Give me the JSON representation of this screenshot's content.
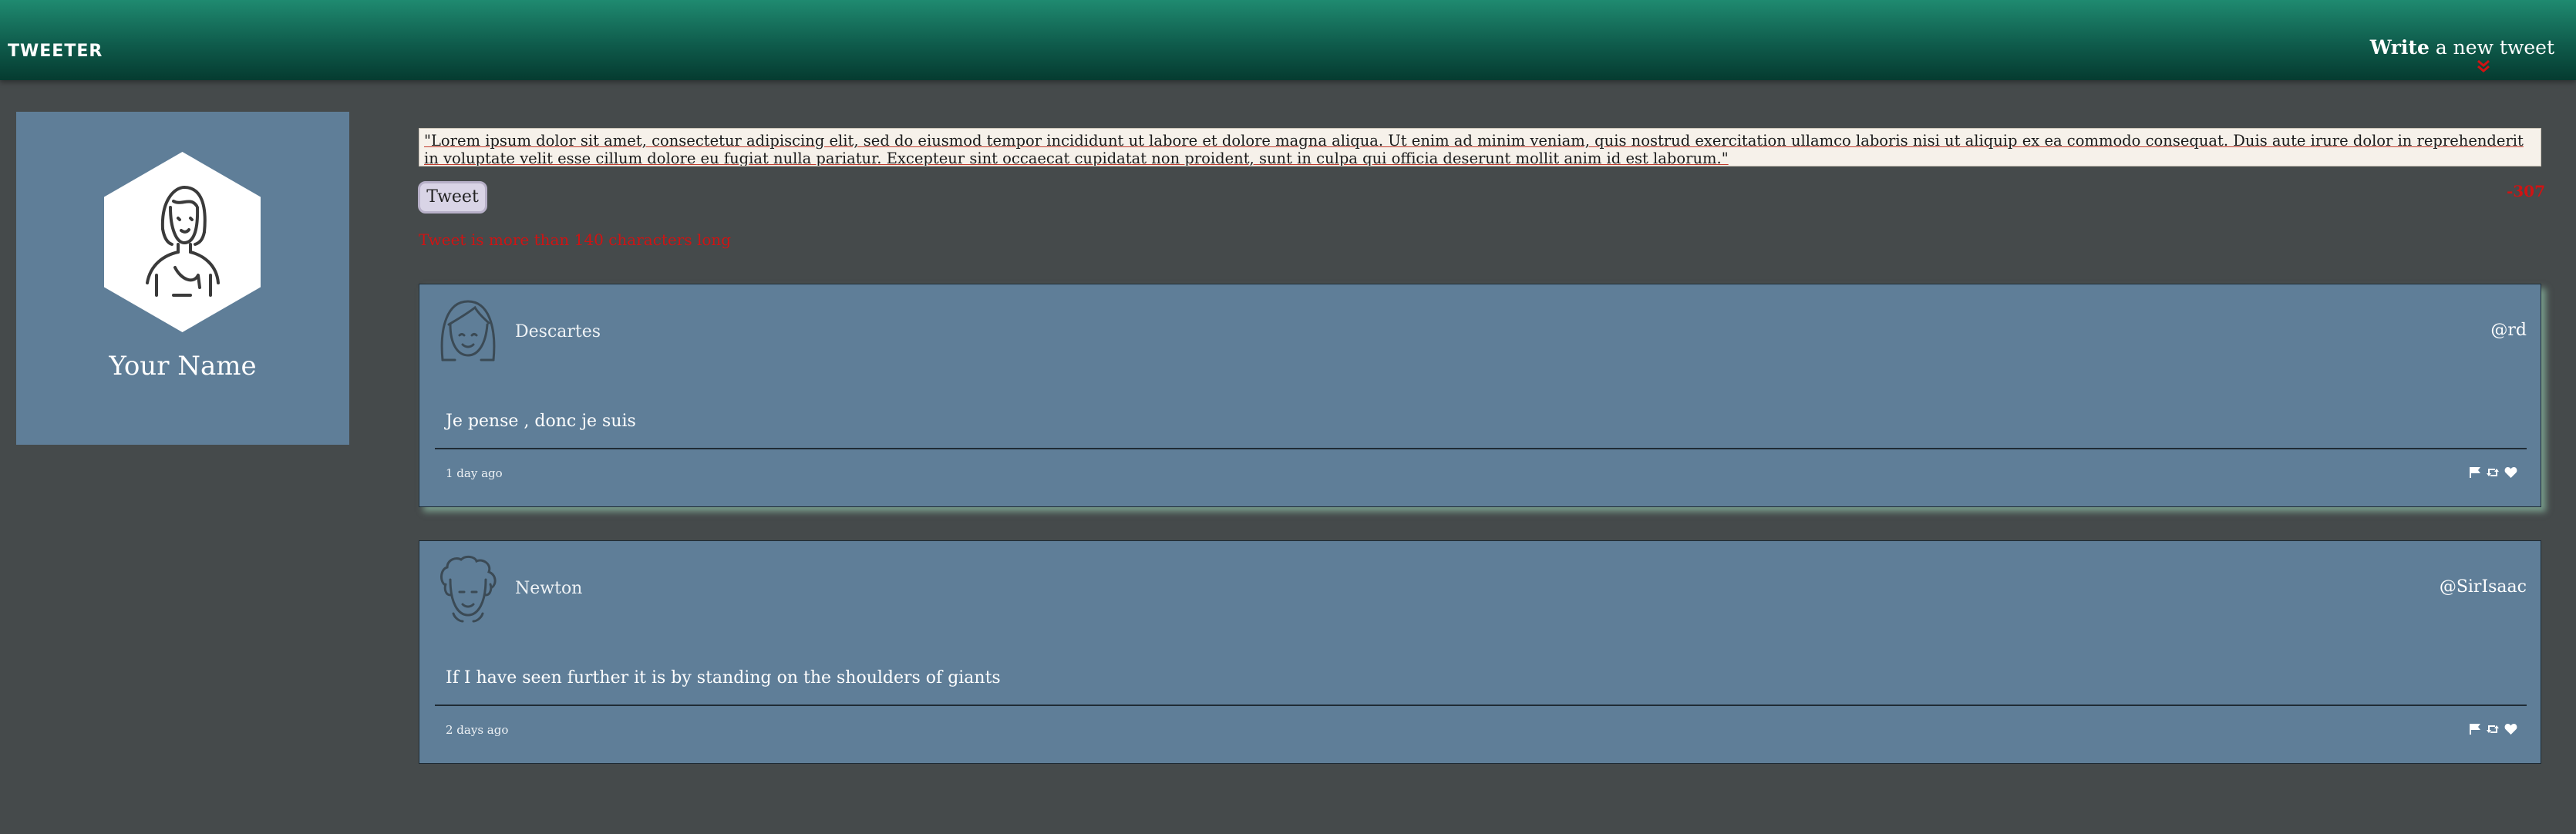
{
  "header": {
    "logo": "TWEETER",
    "write_bold": "Write",
    "write_rest": " a new tweet",
    "chevron_icon": "double-chevron-down-icon",
    "chevron_color": "#d01313"
  },
  "profile": {
    "avatar_icon": "user-avatar-icon",
    "name": "Your Name"
  },
  "composer": {
    "text": "\"Lorem ipsum dolor sit amet, consectetur adipiscing elit, sed do eiusmod tempor incididunt ut labore et dolore magna aliqua. Ut enim ad minim veniam, quis nostrud exercitation ullamco laboris nisi ut aliquip ex ea commodo consequat. Duis aute irure dolor in reprehenderit in voluptate velit esse cillum dolore eu fugiat nulla pariatur. Excepteur sint occaecat cupidatat non proident, sunt in culpa qui officia deserunt mollit anim id est laborum.\"",
    "button_label": "Tweet",
    "counter": "-307",
    "error": "Tweet is more than 140 characters long"
  },
  "tweets": [
    {
      "author": "Descartes",
      "handle": "@rd",
      "text": "Je pense , donc je suis",
      "time": "1 day ago",
      "avatar_icon": "girl-avatar-icon"
    },
    {
      "author": "Newton",
      "handle": "@SirIsaac",
      "text": "If I have seen further it is by standing on the shoulders of giants",
      "time": "2 days ago",
      "avatar_icon": "man-avatar-icon"
    }
  ],
  "colors": {
    "background": "#454a4b",
    "header_top": "#1f8a70",
    "card": "#5f7e98",
    "error": "#d01313"
  }
}
